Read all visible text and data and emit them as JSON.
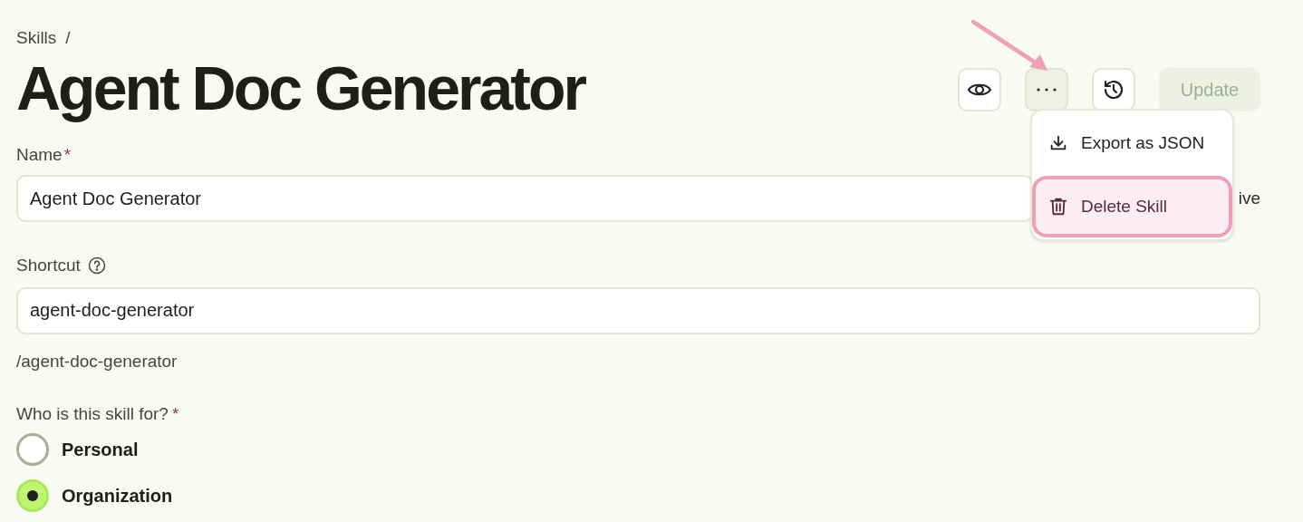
{
  "breadcrumb": {
    "label": "Skills",
    "separator": "/"
  },
  "title": "Agent Doc Generator",
  "toolbar": {
    "more_selected": true,
    "update_label": "Update",
    "update_disabled": true
  },
  "menu": {
    "open": true,
    "items": [
      {
        "kind": "export",
        "label": "Export as JSON",
        "highlighted": false
      },
      {
        "kind": "delete",
        "label": "Delete Skill",
        "highlighted": true
      }
    ]
  },
  "name_field": {
    "label": "Name",
    "required_mark": "*",
    "value": "Agent Doc Generator",
    "side_text": "ive"
  },
  "shortcut_field": {
    "label": "Shortcut",
    "value": "agent-doc-generator",
    "helper": "/agent-doc-generator"
  },
  "audience": {
    "label": "Who is this skill for?",
    "required_mark": "*",
    "options": [
      {
        "label": "Personal",
        "selected": false
      },
      {
        "label": "Organization",
        "selected": true
      }
    ]
  }
}
